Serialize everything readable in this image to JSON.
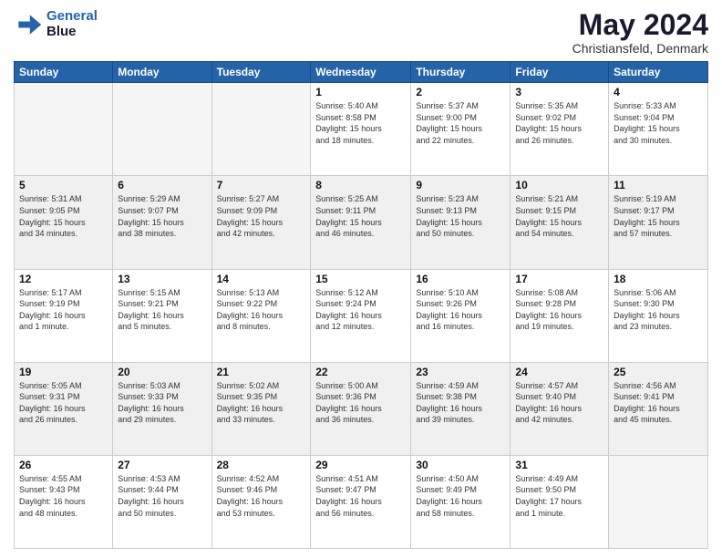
{
  "logo": {
    "line1": "General",
    "line2": "Blue"
  },
  "title": "May 2024",
  "location": "Christiansfeld, Denmark",
  "days_header": [
    "Sunday",
    "Monday",
    "Tuesday",
    "Wednesday",
    "Thursday",
    "Friday",
    "Saturday"
  ],
  "weeks": [
    {
      "alt": false,
      "days": [
        {
          "num": "",
          "info": ""
        },
        {
          "num": "",
          "info": ""
        },
        {
          "num": "",
          "info": ""
        },
        {
          "num": "1",
          "info": "Sunrise: 5:40 AM\nSunset: 8:58 PM\nDaylight: 15 hours\nand 18 minutes."
        },
        {
          "num": "2",
          "info": "Sunrise: 5:37 AM\nSunset: 9:00 PM\nDaylight: 15 hours\nand 22 minutes."
        },
        {
          "num": "3",
          "info": "Sunrise: 5:35 AM\nSunset: 9:02 PM\nDaylight: 15 hours\nand 26 minutes."
        },
        {
          "num": "4",
          "info": "Sunrise: 5:33 AM\nSunset: 9:04 PM\nDaylight: 15 hours\nand 30 minutes."
        }
      ]
    },
    {
      "alt": true,
      "days": [
        {
          "num": "5",
          "info": "Sunrise: 5:31 AM\nSunset: 9:05 PM\nDaylight: 15 hours\nand 34 minutes."
        },
        {
          "num": "6",
          "info": "Sunrise: 5:29 AM\nSunset: 9:07 PM\nDaylight: 15 hours\nand 38 minutes."
        },
        {
          "num": "7",
          "info": "Sunrise: 5:27 AM\nSunset: 9:09 PM\nDaylight: 15 hours\nand 42 minutes."
        },
        {
          "num": "8",
          "info": "Sunrise: 5:25 AM\nSunset: 9:11 PM\nDaylight: 15 hours\nand 46 minutes."
        },
        {
          "num": "9",
          "info": "Sunrise: 5:23 AM\nSunset: 9:13 PM\nDaylight: 15 hours\nand 50 minutes."
        },
        {
          "num": "10",
          "info": "Sunrise: 5:21 AM\nSunset: 9:15 PM\nDaylight: 15 hours\nand 54 minutes."
        },
        {
          "num": "11",
          "info": "Sunrise: 5:19 AM\nSunset: 9:17 PM\nDaylight: 15 hours\nand 57 minutes."
        }
      ]
    },
    {
      "alt": false,
      "days": [
        {
          "num": "12",
          "info": "Sunrise: 5:17 AM\nSunset: 9:19 PM\nDaylight: 16 hours\nand 1 minute."
        },
        {
          "num": "13",
          "info": "Sunrise: 5:15 AM\nSunset: 9:21 PM\nDaylight: 16 hours\nand 5 minutes."
        },
        {
          "num": "14",
          "info": "Sunrise: 5:13 AM\nSunset: 9:22 PM\nDaylight: 16 hours\nand 8 minutes."
        },
        {
          "num": "15",
          "info": "Sunrise: 5:12 AM\nSunset: 9:24 PM\nDaylight: 16 hours\nand 12 minutes."
        },
        {
          "num": "16",
          "info": "Sunrise: 5:10 AM\nSunset: 9:26 PM\nDaylight: 16 hours\nand 16 minutes."
        },
        {
          "num": "17",
          "info": "Sunrise: 5:08 AM\nSunset: 9:28 PM\nDaylight: 16 hours\nand 19 minutes."
        },
        {
          "num": "18",
          "info": "Sunrise: 5:06 AM\nSunset: 9:30 PM\nDaylight: 16 hours\nand 23 minutes."
        }
      ]
    },
    {
      "alt": true,
      "days": [
        {
          "num": "19",
          "info": "Sunrise: 5:05 AM\nSunset: 9:31 PM\nDaylight: 16 hours\nand 26 minutes."
        },
        {
          "num": "20",
          "info": "Sunrise: 5:03 AM\nSunset: 9:33 PM\nDaylight: 16 hours\nand 29 minutes."
        },
        {
          "num": "21",
          "info": "Sunrise: 5:02 AM\nSunset: 9:35 PM\nDaylight: 16 hours\nand 33 minutes."
        },
        {
          "num": "22",
          "info": "Sunrise: 5:00 AM\nSunset: 9:36 PM\nDaylight: 16 hours\nand 36 minutes."
        },
        {
          "num": "23",
          "info": "Sunrise: 4:59 AM\nSunset: 9:38 PM\nDaylight: 16 hours\nand 39 minutes."
        },
        {
          "num": "24",
          "info": "Sunrise: 4:57 AM\nSunset: 9:40 PM\nDaylight: 16 hours\nand 42 minutes."
        },
        {
          "num": "25",
          "info": "Sunrise: 4:56 AM\nSunset: 9:41 PM\nDaylight: 16 hours\nand 45 minutes."
        }
      ]
    },
    {
      "alt": false,
      "days": [
        {
          "num": "26",
          "info": "Sunrise: 4:55 AM\nSunset: 9:43 PM\nDaylight: 16 hours\nand 48 minutes."
        },
        {
          "num": "27",
          "info": "Sunrise: 4:53 AM\nSunset: 9:44 PM\nDaylight: 16 hours\nand 50 minutes."
        },
        {
          "num": "28",
          "info": "Sunrise: 4:52 AM\nSunset: 9:46 PM\nDaylight: 16 hours\nand 53 minutes."
        },
        {
          "num": "29",
          "info": "Sunrise: 4:51 AM\nSunset: 9:47 PM\nDaylight: 16 hours\nand 56 minutes."
        },
        {
          "num": "30",
          "info": "Sunrise: 4:50 AM\nSunset: 9:49 PM\nDaylight: 16 hours\nand 58 minutes."
        },
        {
          "num": "31",
          "info": "Sunrise: 4:49 AM\nSunset: 9:50 PM\nDaylight: 17 hours\nand 1 minute."
        },
        {
          "num": "",
          "info": ""
        }
      ]
    }
  ]
}
